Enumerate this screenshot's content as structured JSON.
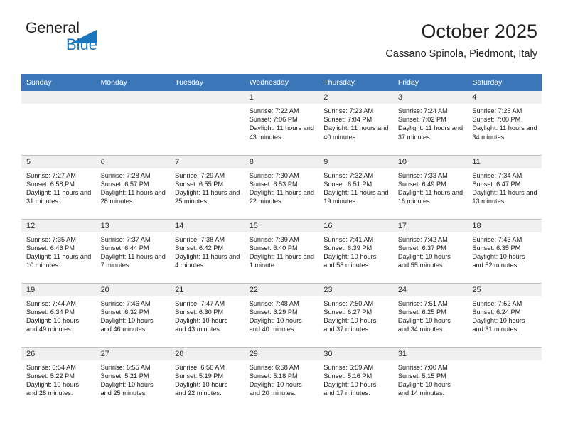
{
  "brand": {
    "name_part1": "General",
    "name_part2": "Blue",
    "logo_icon": "triangle-icon",
    "accent_color": "#1b75bb"
  },
  "header": {
    "title": "October 2025",
    "location": "Cassano Spinola, Piedmont, Italy"
  },
  "theme": {
    "header_blue": "#3b77b8",
    "daynum_strip": "#f0f0f0",
    "grid_line": "#bfbfbf"
  },
  "calendar": {
    "weekday_headers": [
      "Sunday",
      "Monday",
      "Tuesday",
      "Wednesday",
      "Thursday",
      "Friday",
      "Saturday"
    ],
    "weeks": [
      [
        {
          "day": "",
          "empty": true
        },
        {
          "day": "",
          "empty": true
        },
        {
          "day": "",
          "empty": true
        },
        {
          "day": "1",
          "sunrise": "Sunrise: 7:22 AM",
          "sunset": "Sunset: 7:06 PM",
          "daylight": "Daylight: 11 hours and 43 minutes."
        },
        {
          "day": "2",
          "sunrise": "Sunrise: 7:23 AM",
          "sunset": "Sunset: 7:04 PM",
          "daylight": "Daylight: 11 hours and 40 minutes."
        },
        {
          "day": "3",
          "sunrise": "Sunrise: 7:24 AM",
          "sunset": "Sunset: 7:02 PM",
          "daylight": "Daylight: 11 hours and 37 minutes."
        },
        {
          "day": "4",
          "sunrise": "Sunrise: 7:25 AM",
          "sunset": "Sunset: 7:00 PM",
          "daylight": "Daylight: 11 hours and 34 minutes."
        }
      ],
      [
        {
          "day": "5",
          "sunrise": "Sunrise: 7:27 AM",
          "sunset": "Sunset: 6:58 PM",
          "daylight": "Daylight: 11 hours and 31 minutes."
        },
        {
          "day": "6",
          "sunrise": "Sunrise: 7:28 AM",
          "sunset": "Sunset: 6:57 PM",
          "daylight": "Daylight: 11 hours and 28 minutes."
        },
        {
          "day": "7",
          "sunrise": "Sunrise: 7:29 AM",
          "sunset": "Sunset: 6:55 PM",
          "daylight": "Daylight: 11 hours and 25 minutes."
        },
        {
          "day": "8",
          "sunrise": "Sunrise: 7:30 AM",
          "sunset": "Sunset: 6:53 PM",
          "daylight": "Daylight: 11 hours and 22 minutes."
        },
        {
          "day": "9",
          "sunrise": "Sunrise: 7:32 AM",
          "sunset": "Sunset: 6:51 PM",
          "daylight": "Daylight: 11 hours and 19 minutes."
        },
        {
          "day": "10",
          "sunrise": "Sunrise: 7:33 AM",
          "sunset": "Sunset: 6:49 PM",
          "daylight": "Daylight: 11 hours and 16 minutes."
        },
        {
          "day": "11",
          "sunrise": "Sunrise: 7:34 AM",
          "sunset": "Sunset: 6:47 PM",
          "daylight": "Daylight: 11 hours and 13 minutes."
        }
      ],
      [
        {
          "day": "12",
          "sunrise": "Sunrise: 7:35 AM",
          "sunset": "Sunset: 6:46 PM",
          "daylight": "Daylight: 11 hours and 10 minutes."
        },
        {
          "day": "13",
          "sunrise": "Sunrise: 7:37 AM",
          "sunset": "Sunset: 6:44 PM",
          "daylight": "Daylight: 11 hours and 7 minutes."
        },
        {
          "day": "14",
          "sunrise": "Sunrise: 7:38 AM",
          "sunset": "Sunset: 6:42 PM",
          "daylight": "Daylight: 11 hours and 4 minutes."
        },
        {
          "day": "15",
          "sunrise": "Sunrise: 7:39 AM",
          "sunset": "Sunset: 6:40 PM",
          "daylight": "Daylight: 11 hours and 1 minute."
        },
        {
          "day": "16",
          "sunrise": "Sunrise: 7:41 AM",
          "sunset": "Sunset: 6:39 PM",
          "daylight": "Daylight: 10 hours and 58 minutes."
        },
        {
          "day": "17",
          "sunrise": "Sunrise: 7:42 AM",
          "sunset": "Sunset: 6:37 PM",
          "daylight": "Daylight: 10 hours and 55 minutes."
        },
        {
          "day": "18",
          "sunrise": "Sunrise: 7:43 AM",
          "sunset": "Sunset: 6:35 PM",
          "daylight": "Daylight: 10 hours and 52 minutes."
        }
      ],
      [
        {
          "day": "19",
          "sunrise": "Sunrise: 7:44 AM",
          "sunset": "Sunset: 6:34 PM",
          "daylight": "Daylight: 10 hours and 49 minutes."
        },
        {
          "day": "20",
          "sunrise": "Sunrise: 7:46 AM",
          "sunset": "Sunset: 6:32 PM",
          "daylight": "Daylight: 10 hours and 46 minutes."
        },
        {
          "day": "21",
          "sunrise": "Sunrise: 7:47 AM",
          "sunset": "Sunset: 6:30 PM",
          "daylight": "Daylight: 10 hours and 43 minutes."
        },
        {
          "day": "22",
          "sunrise": "Sunrise: 7:48 AM",
          "sunset": "Sunset: 6:29 PM",
          "daylight": "Daylight: 10 hours and 40 minutes."
        },
        {
          "day": "23",
          "sunrise": "Sunrise: 7:50 AM",
          "sunset": "Sunset: 6:27 PM",
          "daylight": "Daylight: 10 hours and 37 minutes."
        },
        {
          "day": "24",
          "sunrise": "Sunrise: 7:51 AM",
          "sunset": "Sunset: 6:25 PM",
          "daylight": "Daylight: 10 hours and 34 minutes."
        },
        {
          "day": "25",
          "sunrise": "Sunrise: 7:52 AM",
          "sunset": "Sunset: 6:24 PM",
          "daylight": "Daylight: 10 hours and 31 minutes."
        }
      ],
      [
        {
          "day": "26",
          "sunrise": "Sunrise: 6:54 AM",
          "sunset": "Sunset: 5:22 PM",
          "daylight": "Daylight: 10 hours and 28 minutes."
        },
        {
          "day": "27",
          "sunrise": "Sunrise: 6:55 AM",
          "sunset": "Sunset: 5:21 PM",
          "daylight": "Daylight: 10 hours and 25 minutes."
        },
        {
          "day": "28",
          "sunrise": "Sunrise: 6:56 AM",
          "sunset": "Sunset: 5:19 PM",
          "daylight": "Daylight: 10 hours and 22 minutes."
        },
        {
          "day": "29",
          "sunrise": "Sunrise: 6:58 AM",
          "sunset": "Sunset: 5:18 PM",
          "daylight": "Daylight: 10 hours and 20 minutes."
        },
        {
          "day": "30",
          "sunrise": "Sunrise: 6:59 AM",
          "sunset": "Sunset: 5:16 PM",
          "daylight": "Daylight: 10 hours and 17 minutes."
        },
        {
          "day": "31",
          "sunrise": "Sunrise: 7:00 AM",
          "sunset": "Sunset: 5:15 PM",
          "daylight": "Daylight: 10 hours and 14 minutes."
        },
        {
          "day": "",
          "empty": true
        }
      ]
    ]
  }
}
